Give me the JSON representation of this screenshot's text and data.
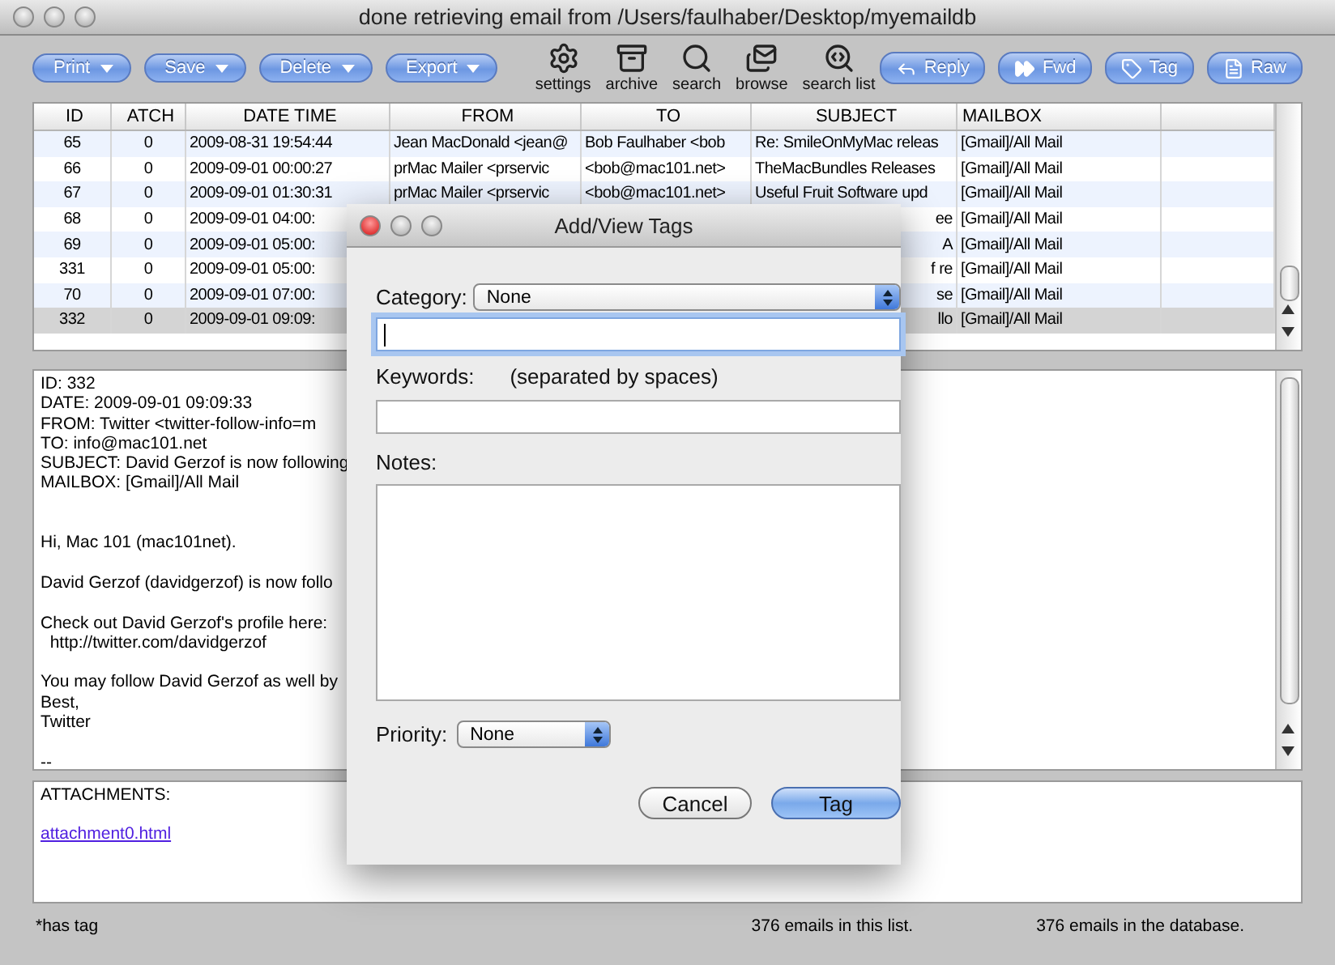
{
  "window": {
    "title": "done retrieving email from /Users/faulhaber/Desktop/myemaildb"
  },
  "toolbar": {
    "menus": [
      {
        "label": "Print"
      },
      {
        "label": "Save"
      },
      {
        "label": "Delete"
      },
      {
        "label": "Export"
      }
    ],
    "tools": [
      {
        "label": "settings",
        "kind": "settings"
      },
      {
        "label": "archive",
        "kind": "archive"
      },
      {
        "label": "search",
        "kind": "search"
      },
      {
        "label": "browse",
        "kind": "browse"
      },
      {
        "label": "search list",
        "kind": "searchlist"
      }
    ],
    "actions": [
      {
        "label": "Reply",
        "kind": "reply"
      },
      {
        "label": "Fwd",
        "kind": "forward"
      },
      {
        "label": "Tag",
        "kind": "tag"
      },
      {
        "label": "Raw",
        "kind": "raw"
      }
    ]
  },
  "table": {
    "columns": [
      "ID",
      "ATCH",
      "DATE TIME",
      "FROM",
      "TO",
      "SUBJECT",
      "MAILBOX"
    ],
    "rows": [
      {
        "id": "65",
        "atch": "0",
        "date_time": "2009-08-31 19:54:44",
        "from": "Jean MacDonald <jean@",
        "to": "Bob Faulhaber <bob",
        "subject": "Re: SmileOnMyMac releas",
        "mailbox": "[Gmail]/All Mail",
        "selected": false
      },
      {
        "id": "66",
        "atch": "0",
        "date_time": "2009-09-01 00:00:27",
        "from": "prMac Mailer <prservic",
        "to": "<bob@mac101.net>",
        "subject": "TheMacBundles Releases",
        "mailbox": "[Gmail]/All Mail",
        "selected": false
      },
      {
        "id": "67",
        "atch": "0",
        "date_time": "2009-09-01 01:30:31",
        "from": "prMac Mailer <prservic",
        "to": "<bob@mac101.net>",
        "subject": "Useful Fruit Software upd",
        "mailbox": "[Gmail]/All Mail",
        "selected": false
      },
      {
        "id": "68",
        "atch": "0",
        "date_time": "2009-09-01 04:00:",
        "subject": "ee",
        "mailbox": "[Gmail]/All Mail",
        "selected": false
      },
      {
        "id": "69",
        "atch": "0",
        "date_time": "2009-09-01 05:00:",
        "subject": "A",
        "mailbox": "[Gmail]/All Mail",
        "selected": false
      },
      {
        "id": "331",
        "atch": "0",
        "date_time": "2009-09-01 05:00:",
        "subject": "f re",
        "mailbox": "[Gmail]/All Mail",
        "selected": false
      },
      {
        "id": "70",
        "atch": "0",
        "date_time": "2009-09-01 07:00:",
        "subject": "se",
        "mailbox": "[Gmail]/All Mail",
        "selected": false
      },
      {
        "id": "332",
        "atch": "0",
        "date_time": "2009-09-01 09:09:",
        "subject": "llo",
        "mailbox": "[Gmail]/All Mail",
        "selected": true
      }
    ]
  },
  "message": {
    "header": [
      "ID: 332",
      "DATE: 2009-09-01 09:09:33",
      "FROM: Twitter <twitter-follow-info=m",
      "TO: info@mac101.net",
      "SUBJECT: David Gerzof is now following",
      "MAILBOX: [Gmail]/All Mail"
    ],
    "paragraphs": [
      [
        "Hi, Mac 101 (mac101net)."
      ],
      [
        "David Gerzof (davidgerzof) is now follo"
      ],
      [
        "Check out David Gerzof's profile here:",
        "  http://twitter.com/davidgerzof"
      ],
      [
        "You may follow David Gerzof as well by",
        "Best,",
        "Twitter"
      ],
      [
        "--"
      ]
    ]
  },
  "attachments": {
    "heading": "ATTACHMENTS:",
    "links": [
      "attachment0.html"
    ]
  },
  "status_bar": {
    "note": "*has tag",
    "list_count": "376 emails in this list.",
    "db_count": "376 emails in the database."
  },
  "dialog": {
    "title": "Add/View Tags",
    "category": {
      "label": "Category:",
      "value": "None"
    },
    "tag_field": {
      "focused": true
    },
    "keywords": {
      "label": "Keywords:",
      "hint": "(separated by spaces)"
    },
    "notes": {
      "label": "Notes:"
    },
    "priority": {
      "label": "Priority:",
      "value": "None"
    },
    "buttons": [
      {
        "label": "Cancel",
        "default": false
      },
      {
        "label": "Tag",
        "default": true
      }
    ]
  }
}
